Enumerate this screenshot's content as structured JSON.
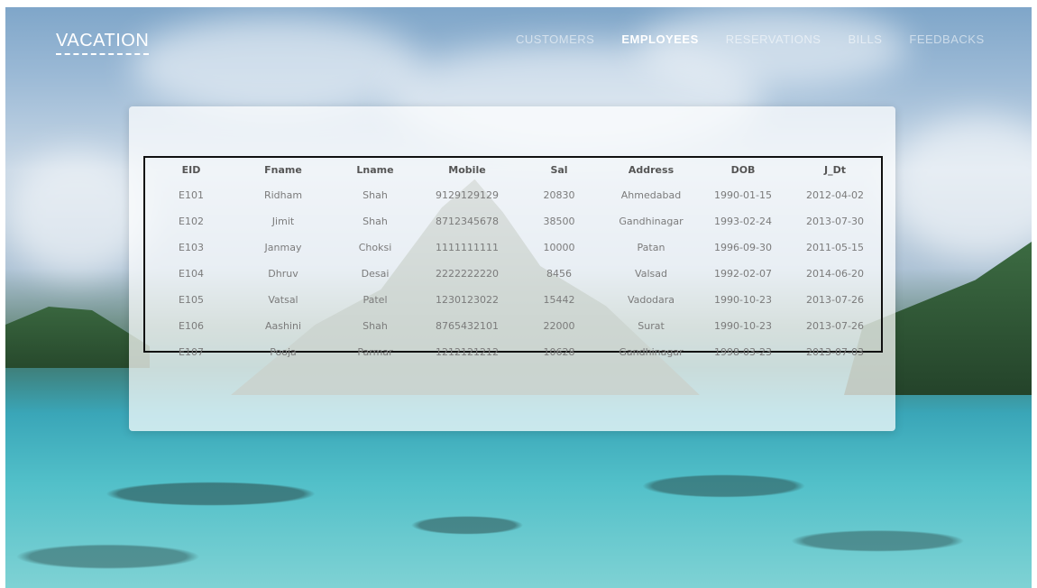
{
  "brand": {
    "logo": "VACATION"
  },
  "nav": {
    "items": [
      "CUSTOMERS",
      "EMPLOYEES",
      "RESERVATIONS",
      "BILLS",
      "FEEDBACKS"
    ],
    "active": "EMPLOYEES"
  },
  "employees": {
    "columns": [
      "EID",
      "Fname",
      "Lname",
      "Mobile",
      "Sal",
      "Address",
      "DOB",
      "J_Dt"
    ],
    "rows": [
      [
        "E101",
        "Ridham",
        "Shah",
        "9129129129",
        "20830",
        "Ahmedabad",
        "1990-01-15",
        "2012-04-02"
      ],
      [
        "E102",
        "Jimit",
        "Shah",
        "8712345678",
        "38500",
        "Gandhinagar",
        "1993-02-24",
        "2013-07-30"
      ],
      [
        "E103",
        "Janmay",
        "Choksi",
        "1111111111",
        "10000",
        "Patan",
        "1996-09-30",
        "2011-05-15"
      ],
      [
        "E104",
        "Dhruv",
        "Desai",
        "2222222220",
        "8456",
        "Valsad",
        "1992-02-07",
        "2014-06-20"
      ],
      [
        "E105",
        "Vatsal",
        "Patel",
        "1230123022",
        "15442",
        "Vadodara",
        "1990-10-23",
        "2013-07-26"
      ],
      [
        "E106",
        "Aashini",
        "Shah",
        "8765432101",
        "22000",
        "Surat",
        "1990-10-23",
        "2013-07-26"
      ],
      [
        "E107",
        "Pooja",
        "Parmar",
        "1212121212",
        "10628",
        "Gandhinagar",
        "1998-03-23",
        "2013-07-03"
      ]
    ]
  }
}
